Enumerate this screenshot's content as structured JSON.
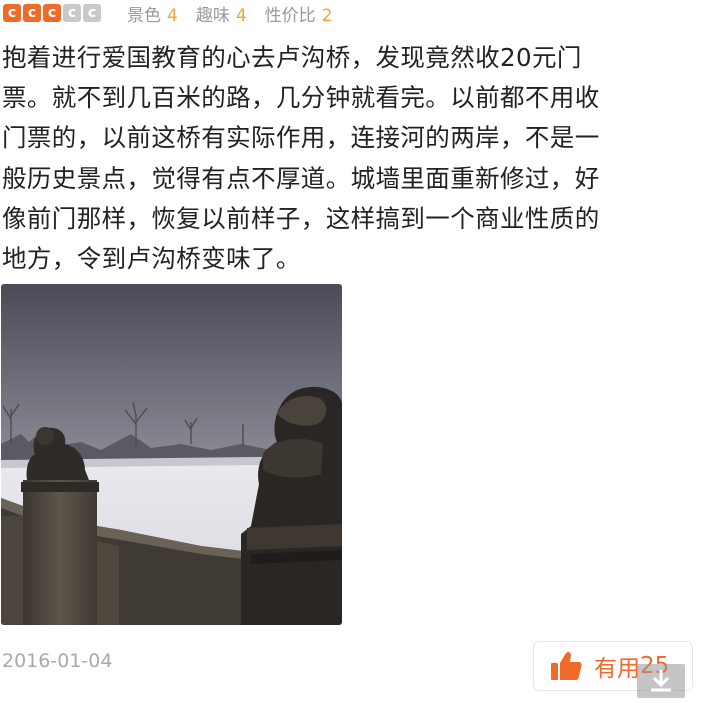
{
  "rating": {
    "pips": [
      "c",
      "c",
      "c",
      "c",
      "c"
    ],
    "pips_filled": 3,
    "items": [
      {
        "label": "景色",
        "score": "4"
      },
      {
        "label": "趣味",
        "score": "4"
      },
      {
        "label": "性价比",
        "score": "2"
      }
    ]
  },
  "review": {
    "lines": [
      "抱着进行爱国教育的心去卢沟桥，发现竟然收20元门",
      "票。就不到几百米的路，几分钟就看完。以前都不用收",
      "门票的，以前这桥有实际作用，连接河的两岸，不是一",
      "般历史景点，觉得有点不厚道。城墙里面重新修过，好",
      "像前门那样，恢复以前样子，这样搞到一个商业性质的",
      "地方，令到卢沟桥变味了。"
    ]
  },
  "date": "2016-01-04",
  "useful": {
    "label": "有用",
    "count": "25"
  },
  "colors": {
    "accent": "#f06a2a",
    "score": "#f5a23a",
    "muted": "#aaaaaa"
  },
  "icons": {
    "thumb": "thumbs-up-icon",
    "download": "download-icon"
  }
}
